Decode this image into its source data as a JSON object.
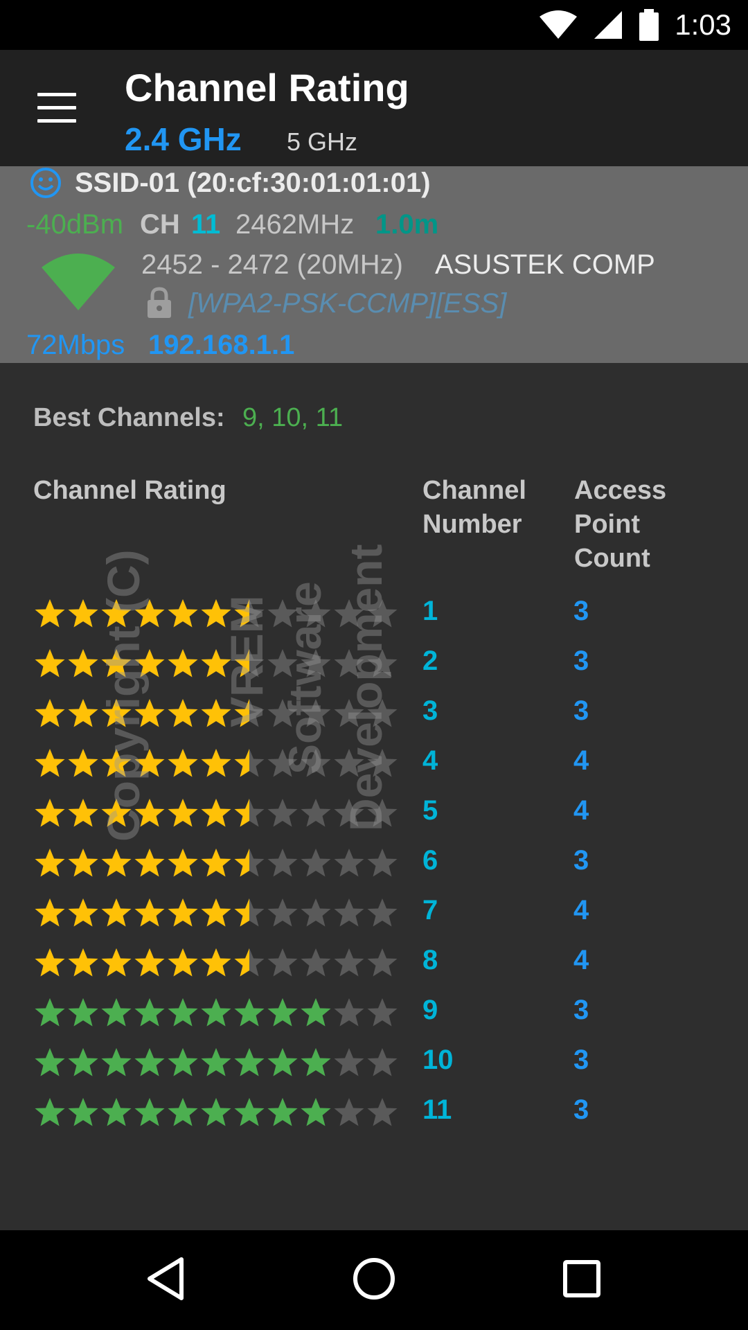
{
  "status_bar": {
    "time": "1:03"
  },
  "toolbar": {
    "title": "Channel Rating",
    "tab_24": "2.4 GHz",
    "tab_5": "5 GHz"
  },
  "access_point": {
    "ssid": "SSID-01 (20:cf:30:01:01:01)",
    "signal": "-40dBm",
    "channel_label": "CH",
    "channel": "11",
    "frequency": "2462MHz",
    "distance": "1.0m",
    "range": "2452 - 2472 (20MHz)",
    "vendor": "ASUSTEK COMP",
    "security": "[WPA2-PSK-CCMP][ESS]",
    "link_speed": "72Mbps",
    "ip": "192.168.1.1"
  },
  "best": {
    "label": "Best Channels:",
    "value": "9, 10, 11"
  },
  "headers": {
    "rating": "Channel Rating",
    "number": "Channel Number",
    "count": "Access Point Count"
  },
  "watermark": [
    "Copyright (C)",
    "VREM",
    "Software",
    "Development"
  ],
  "colors": {
    "star_yellow": "#ffc107",
    "star_green": "#4caf50",
    "star_empty": "#5a5a5a"
  },
  "rating_max": 11,
  "ratings": [
    {
      "channel": "1",
      "count": "3",
      "stars": 6.5,
      "best": false
    },
    {
      "channel": "2",
      "count": "3",
      "stars": 6.5,
      "best": false
    },
    {
      "channel": "3",
      "count": "3",
      "stars": 6.5,
      "best": false
    },
    {
      "channel": "4",
      "count": "4",
      "stars": 6.5,
      "best": false
    },
    {
      "channel": "5",
      "count": "4",
      "stars": 6.5,
      "best": false
    },
    {
      "channel": "6",
      "count": "3",
      "stars": 6.5,
      "best": false
    },
    {
      "channel": "7",
      "count": "4",
      "stars": 6.5,
      "best": false
    },
    {
      "channel": "8",
      "count": "4",
      "stars": 6.5,
      "best": false
    },
    {
      "channel": "9",
      "count": "3",
      "stars": 9,
      "best": true
    },
    {
      "channel": "10",
      "count": "3",
      "stars": 9,
      "best": true
    },
    {
      "channel": "11",
      "count": "3",
      "stars": 9,
      "best": true
    }
  ]
}
